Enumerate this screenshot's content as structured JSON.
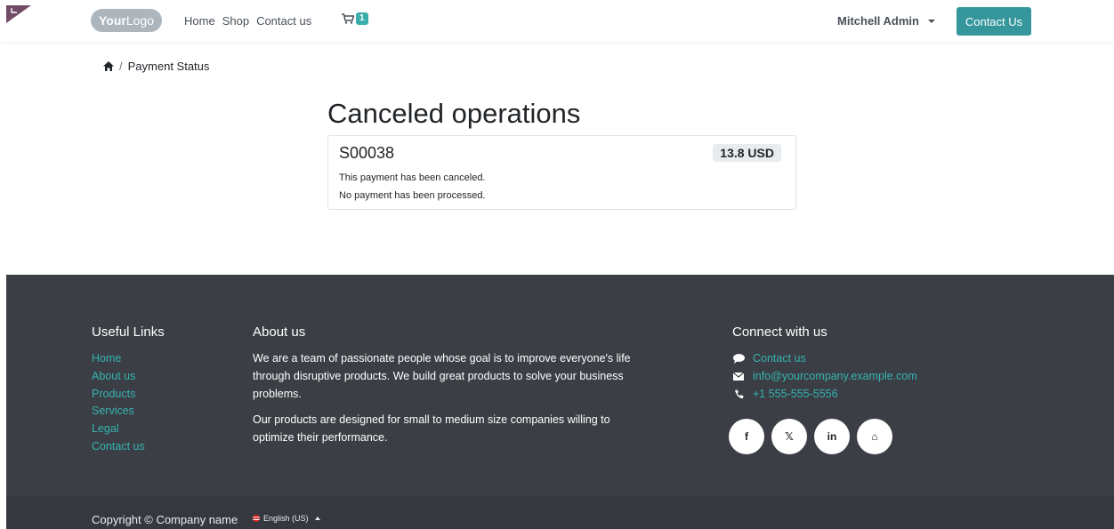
{
  "header": {
    "logo_text_bold": "Your",
    "logo_text": "Logo",
    "nav": [
      "Home",
      "Shop",
      "Contact us"
    ],
    "cart_count": "1",
    "user": "Mitchell Admin",
    "contact_button": "Contact Us"
  },
  "breadcrumb": {
    "current": "Payment Status"
  },
  "main": {
    "title": "Canceled operations",
    "payment": {
      "reference": "S00038",
      "amount": "13.8 USD",
      "line1": "This payment has been canceled.",
      "line2": "No payment has been processed."
    }
  },
  "footer": {
    "links_title": "Useful Links",
    "links": [
      "Home",
      "About us",
      "Products",
      "Services",
      "Legal",
      "Contact us"
    ],
    "about_title": "About us",
    "about_p1": "We are a team of passionate people whose goal is to improve everyone's life through disruptive products. We build great products to solve your business problems.",
    "about_p2": "Our products are designed for small to medium size companies willing to optimize their performance.",
    "connect_title": "Connect with us",
    "connect": [
      {
        "icon": "chat-icon",
        "text": "Contact us"
      },
      {
        "icon": "envelope-icon",
        "text": "info@yourcompany.example.com"
      },
      {
        "icon": "phone-icon",
        "text": "+1 555-555-5556"
      }
    ],
    "socials": [
      {
        "icon": "facebook-icon",
        "label": "f"
      },
      {
        "icon": "x-twitter-icon",
        "label": "𝕏"
      },
      {
        "icon": "linkedin-icon",
        "label": "in"
      },
      {
        "icon": "home-icon",
        "label": "⌂"
      }
    ],
    "copyright": "Copyright © Company name",
    "language": "English (US)"
  },
  "colors": {
    "accent": "#35979c",
    "link": "#35b4b0",
    "footer_bg": "#3b3e44",
    "copyright_bg": "#35383e",
    "corner": "#714b67"
  }
}
